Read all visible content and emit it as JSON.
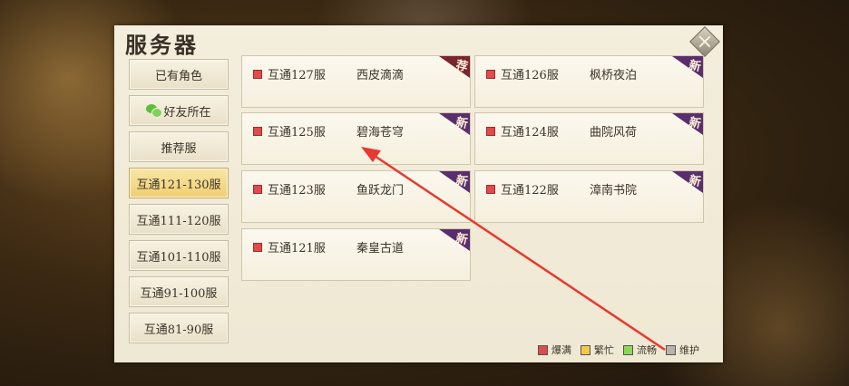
{
  "panel": {
    "title": "服务器"
  },
  "sidebar": {
    "items": [
      {
        "label": "已有角色",
        "active": false,
        "icon": ""
      },
      {
        "label": "好友所在",
        "active": false,
        "icon": "wechat-icon"
      },
      {
        "label": "推荐服",
        "active": false,
        "icon": ""
      },
      {
        "label": "互通121-130服",
        "active": true,
        "icon": ""
      },
      {
        "label": "互通111-120服",
        "active": false,
        "icon": ""
      },
      {
        "label": "互通101-110服",
        "active": false,
        "icon": ""
      },
      {
        "label": "互通91-100服",
        "active": false,
        "icon": ""
      },
      {
        "label": "互通81-90服",
        "active": false,
        "icon": ""
      }
    ]
  },
  "servers": [
    {
      "id": "互通127服",
      "name": "西皮滴滴",
      "tag": "荐",
      "status_color": "#e04b4b"
    },
    {
      "id": "互通126服",
      "name": "枫桥夜泊",
      "tag": "新",
      "status_color": "#e04b4b"
    },
    {
      "id": "互通125服",
      "name": "碧海苍穹",
      "tag": "新",
      "status_color": "#e04b4b"
    },
    {
      "id": "互通124服",
      "name": "曲院风荷",
      "tag": "新",
      "status_color": "#e04b4b"
    },
    {
      "id": "互通123服",
      "name": "鱼跃龙门",
      "tag": "新",
      "status_color": "#e04b4b"
    },
    {
      "id": "互通122服",
      "name": "漳南书院",
      "tag": "新",
      "status_color": "#e04b4b"
    },
    {
      "id": "互通121服",
      "name": "秦皇古道",
      "tag": "新",
      "status_color": "#e04b4b"
    }
  ],
  "legend": [
    {
      "label": "爆满",
      "color": "#e04b4b"
    },
    {
      "label": "繁忙",
      "color": "#f2c84a"
    },
    {
      "label": "流畅",
      "color": "#8ed65a"
    },
    {
      "label": "维护",
      "color": "#b8b3ab"
    }
  ],
  "annotation": {
    "arrow_color": "#e8382f"
  }
}
